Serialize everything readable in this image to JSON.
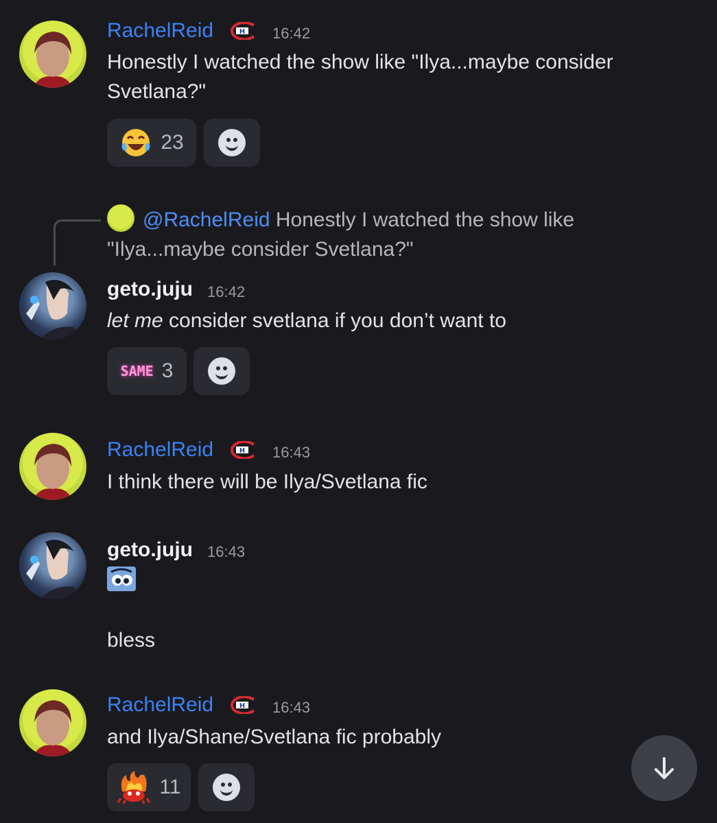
{
  "messages": [
    {
      "user": "RachelReid",
      "time": "16:42",
      "text": "Honestly I watched the show like \"Ilya...maybe consider Svetlana?\"",
      "reaction_emoji": "laughing-crying-emoji",
      "reaction_count": "23"
    },
    {
      "user": "geto.juju",
      "time": "16:42",
      "reply_user": "@RachelReid",
      "reply_text": "Honestly I watched the show like \"Ilya...maybe consider Svetlana?\"",
      "text_italic": "let me",
      "text_rest": " consider svetlana if you don’t want to",
      "reaction_label": "SAME",
      "reaction_count": "3"
    },
    {
      "user": "RachelReid",
      "time": "16:43",
      "text": "I think there will be Ilya/Svetlana fic"
    },
    {
      "user": "geto.juju",
      "time": "16:43",
      "sticker": "blue-cartoon-sticker",
      "text": "bless"
    },
    {
      "user": "RachelReid",
      "time": "16:43",
      "text": "and Ilya/Shane/Svetlana fic probably",
      "reaction_emoji": "fire-crab-emoji",
      "reaction_count": "11"
    }
  ],
  "colors": {
    "background": "#1a1a1e",
    "rachel_name": "#3b82f6",
    "mention": "#4d8ef7",
    "reaction_bg": "#2a2b31"
  },
  "icons": {
    "role_badge": "canadiens-logo-icon",
    "add_reaction": "smiley-add-reaction-icon",
    "scroll": "arrow-down-icon"
  }
}
